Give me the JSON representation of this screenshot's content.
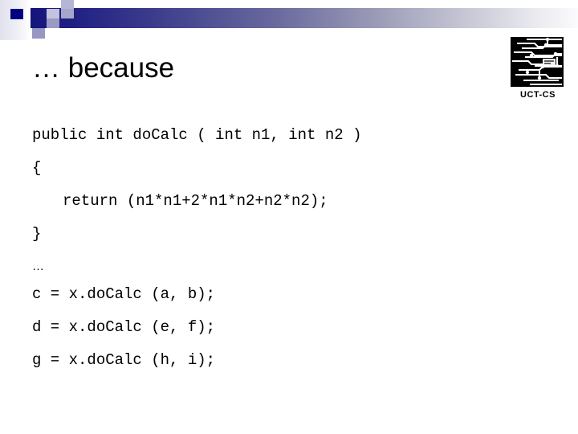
{
  "slide": {
    "title": "… because",
    "logo": {
      "alt_name": "uct-cs-circuit-logo",
      "caption": "UCT-CS"
    },
    "code_lines": [
      {
        "text": "public int doCalc ( int n1, int n2 )",
        "style": "code"
      },
      {
        "text": "{",
        "style": "code"
      },
      {
        "text": "return (n1*n1+2*n1*n2+n2*n2);",
        "style": "code-indent"
      },
      {
        "text": "}",
        "style": "code"
      },
      {
        "text": "…",
        "style": "ellipsis"
      },
      {
        "text": "c = x.doCalc (a, b);",
        "style": "code"
      },
      {
        "text": "d = x.doCalc (e, f);",
        "style": "code"
      },
      {
        "text": "g = x.doCalc (h, i);",
        "style": "code"
      }
    ]
  },
  "colors": {
    "background": "#ffffff",
    "band_dark": "#14147a",
    "band_light": "#fbfbfd",
    "accent_navy": "#000080",
    "accent_mid": "#9a9ac4",
    "accent_pale": "#c3c3dd",
    "text": "#000000"
  }
}
